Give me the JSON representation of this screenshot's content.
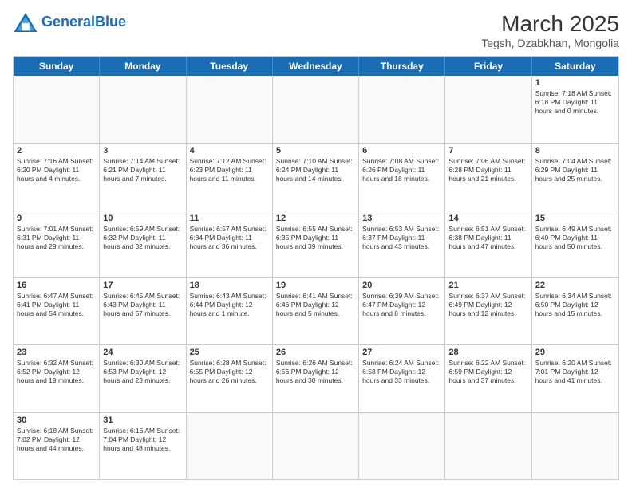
{
  "logo": {
    "general": "General",
    "blue": "Blue"
  },
  "title": {
    "month_year": "March 2025",
    "location": "Tegsh, Dzabkhan, Mongolia"
  },
  "day_headers": [
    "Sunday",
    "Monday",
    "Tuesday",
    "Wednesday",
    "Thursday",
    "Friday",
    "Saturday"
  ],
  "weeks": [
    [
      {
        "date": "",
        "empty": true
      },
      {
        "date": "",
        "empty": true
      },
      {
        "date": "",
        "empty": true
      },
      {
        "date": "",
        "empty": true
      },
      {
        "date": "",
        "empty": true
      },
      {
        "date": "",
        "empty": true
      },
      {
        "date": "1",
        "info": "Sunrise: 7:18 AM\nSunset: 6:18 PM\nDaylight: 11 hours\nand 0 minutes."
      }
    ],
    [
      {
        "date": "2",
        "info": "Sunrise: 7:16 AM\nSunset: 6:20 PM\nDaylight: 11 hours\nand 4 minutes."
      },
      {
        "date": "3",
        "info": "Sunrise: 7:14 AM\nSunset: 6:21 PM\nDaylight: 11 hours\nand 7 minutes."
      },
      {
        "date": "4",
        "info": "Sunrise: 7:12 AM\nSunset: 6:23 PM\nDaylight: 11 hours\nand 11 minutes."
      },
      {
        "date": "5",
        "info": "Sunrise: 7:10 AM\nSunset: 6:24 PM\nDaylight: 11 hours\nand 14 minutes."
      },
      {
        "date": "6",
        "info": "Sunrise: 7:08 AM\nSunset: 6:26 PM\nDaylight: 11 hours\nand 18 minutes."
      },
      {
        "date": "7",
        "info": "Sunrise: 7:06 AM\nSunset: 6:28 PM\nDaylight: 11 hours\nand 21 minutes."
      },
      {
        "date": "8",
        "info": "Sunrise: 7:04 AM\nSunset: 6:29 PM\nDaylight: 11 hours\nand 25 minutes."
      }
    ],
    [
      {
        "date": "9",
        "info": "Sunrise: 7:01 AM\nSunset: 6:31 PM\nDaylight: 11 hours\nand 29 minutes."
      },
      {
        "date": "10",
        "info": "Sunrise: 6:59 AM\nSunset: 6:32 PM\nDaylight: 11 hours\nand 32 minutes."
      },
      {
        "date": "11",
        "info": "Sunrise: 6:57 AM\nSunset: 6:34 PM\nDaylight: 11 hours\nand 36 minutes."
      },
      {
        "date": "12",
        "info": "Sunrise: 6:55 AM\nSunset: 6:35 PM\nDaylight: 11 hours\nand 39 minutes."
      },
      {
        "date": "13",
        "info": "Sunrise: 6:53 AM\nSunset: 6:37 PM\nDaylight: 11 hours\nand 43 minutes."
      },
      {
        "date": "14",
        "info": "Sunrise: 6:51 AM\nSunset: 6:38 PM\nDaylight: 11 hours\nand 47 minutes."
      },
      {
        "date": "15",
        "info": "Sunrise: 6:49 AM\nSunset: 6:40 PM\nDaylight: 11 hours\nand 50 minutes."
      }
    ],
    [
      {
        "date": "16",
        "info": "Sunrise: 6:47 AM\nSunset: 6:41 PM\nDaylight: 11 hours\nand 54 minutes."
      },
      {
        "date": "17",
        "info": "Sunrise: 6:45 AM\nSunset: 6:43 PM\nDaylight: 11 hours\nand 57 minutes."
      },
      {
        "date": "18",
        "info": "Sunrise: 6:43 AM\nSunset: 6:44 PM\nDaylight: 12 hours\nand 1 minute."
      },
      {
        "date": "19",
        "info": "Sunrise: 6:41 AM\nSunset: 6:46 PM\nDaylight: 12 hours\nand 5 minutes."
      },
      {
        "date": "20",
        "info": "Sunrise: 6:39 AM\nSunset: 6:47 PM\nDaylight: 12 hours\nand 8 minutes."
      },
      {
        "date": "21",
        "info": "Sunrise: 6:37 AM\nSunset: 6:49 PM\nDaylight: 12 hours\nand 12 minutes."
      },
      {
        "date": "22",
        "info": "Sunrise: 6:34 AM\nSunset: 6:50 PM\nDaylight: 12 hours\nand 15 minutes."
      }
    ],
    [
      {
        "date": "23",
        "info": "Sunrise: 6:32 AM\nSunset: 6:52 PM\nDaylight: 12 hours\nand 19 minutes."
      },
      {
        "date": "24",
        "info": "Sunrise: 6:30 AM\nSunset: 6:53 PM\nDaylight: 12 hours\nand 23 minutes."
      },
      {
        "date": "25",
        "info": "Sunrise: 6:28 AM\nSunset: 6:55 PM\nDaylight: 12 hours\nand 26 minutes."
      },
      {
        "date": "26",
        "info": "Sunrise: 6:26 AM\nSunset: 6:56 PM\nDaylight: 12 hours\nand 30 minutes."
      },
      {
        "date": "27",
        "info": "Sunrise: 6:24 AM\nSunset: 6:58 PM\nDaylight: 12 hours\nand 33 minutes."
      },
      {
        "date": "28",
        "info": "Sunrise: 6:22 AM\nSunset: 6:59 PM\nDaylight: 12 hours\nand 37 minutes."
      },
      {
        "date": "29",
        "info": "Sunrise: 6:20 AM\nSunset: 7:01 PM\nDaylight: 12 hours\nand 41 minutes."
      }
    ],
    [
      {
        "date": "30",
        "info": "Sunrise: 6:18 AM\nSunset: 7:02 PM\nDaylight: 12 hours\nand 44 minutes."
      },
      {
        "date": "31",
        "info": "Sunrise: 6:16 AM\nSunset: 7:04 PM\nDaylight: 12 hours\nand 48 minutes."
      },
      {
        "date": "",
        "empty": true
      },
      {
        "date": "",
        "empty": true
      },
      {
        "date": "",
        "empty": true
      },
      {
        "date": "",
        "empty": true
      },
      {
        "date": "",
        "empty": true
      }
    ]
  ]
}
